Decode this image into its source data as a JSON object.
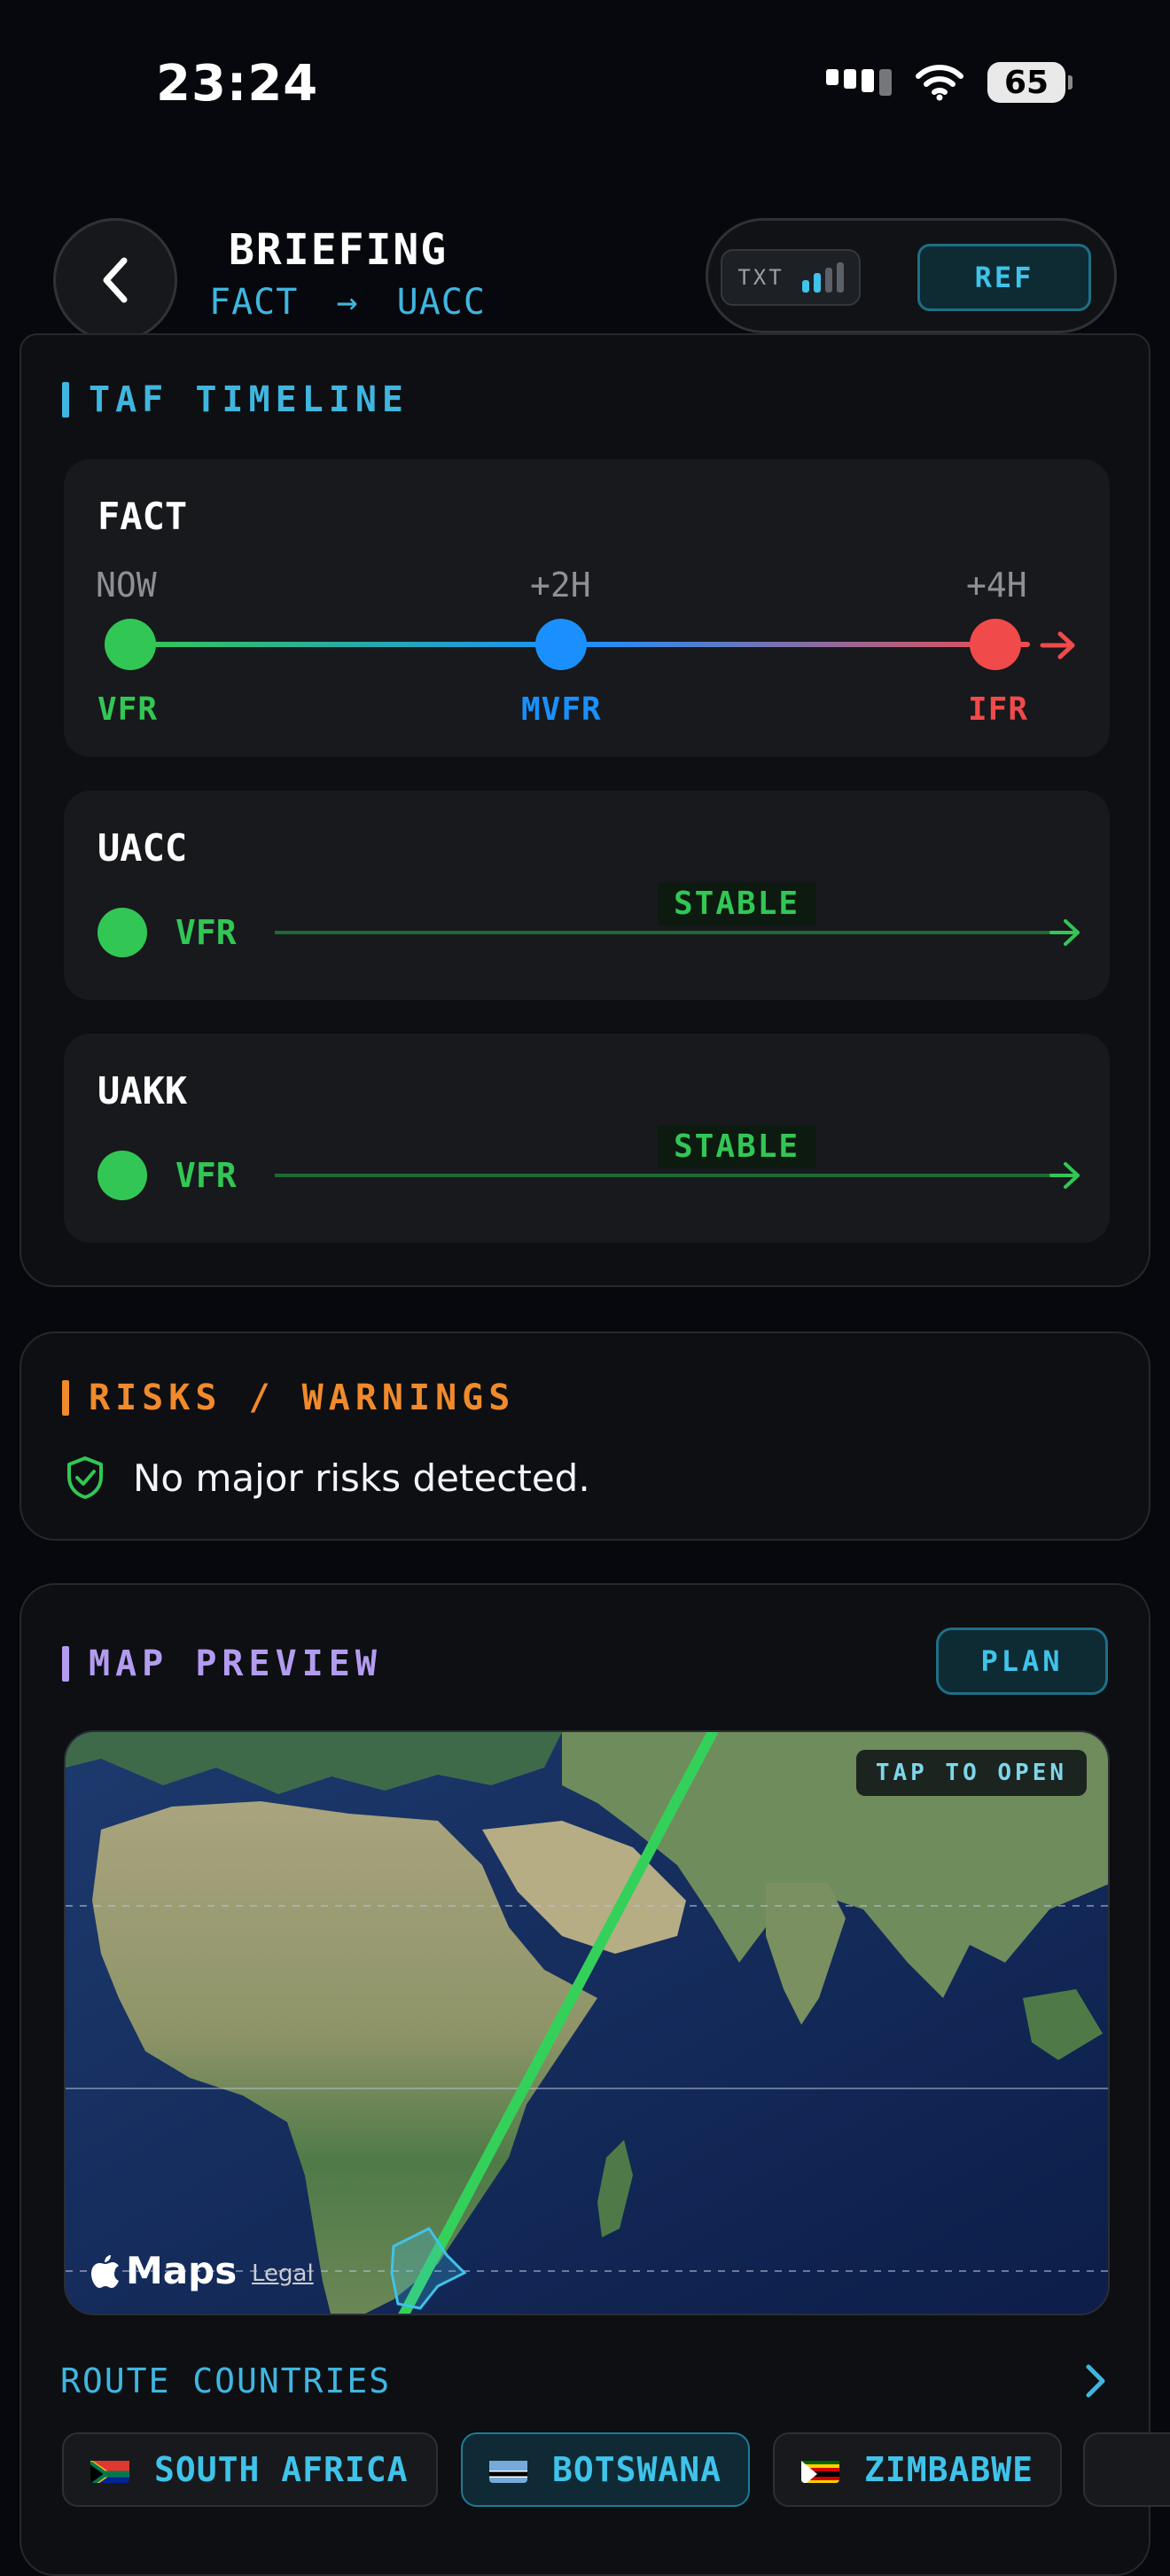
{
  "status_bar": {
    "time": "23:24",
    "battery": "65"
  },
  "header": {
    "title": "BRIEFING",
    "route_from": "FACT",
    "route_to": "UACC",
    "txt_label": "TXT",
    "ref_label": "REF"
  },
  "taf_timeline": {
    "title": "TAF TIMELINE",
    "stations": [
      {
        "code": "FACT",
        "steps": [
          {
            "time": "NOW",
            "condition": "VFR"
          },
          {
            "time": "+2H",
            "condition": "MVFR"
          },
          {
            "time": "+4H",
            "condition": "IFR"
          }
        ]
      },
      {
        "code": "UACC",
        "condition": "VFR",
        "trend": "STABLE"
      },
      {
        "code": "UAKK",
        "condition": "VFR",
        "trend": "STABLE"
      }
    ]
  },
  "risks": {
    "title": "RISKS / WARNINGS",
    "message": "No major risks detected."
  },
  "map_preview": {
    "title": "MAP PREVIEW",
    "plan_label": "PLAN",
    "tap_label": "TAP TO OPEN",
    "maps_label": "Maps",
    "legal_label": "Legal"
  },
  "route_countries": {
    "title": "ROUTE COUNTRIES",
    "countries": [
      "SOUTH AFRICA",
      "BOTSWANA",
      "ZIMBABWE"
    ],
    "selected": "BOTSWANA"
  },
  "colors": {
    "vfr": "#32c755",
    "mvfr": "#1a90ff",
    "ifr": "#f14a4a",
    "accent": "#3fc3ea",
    "warning": "#f08a2c",
    "map_accent": "#b39cf0"
  }
}
